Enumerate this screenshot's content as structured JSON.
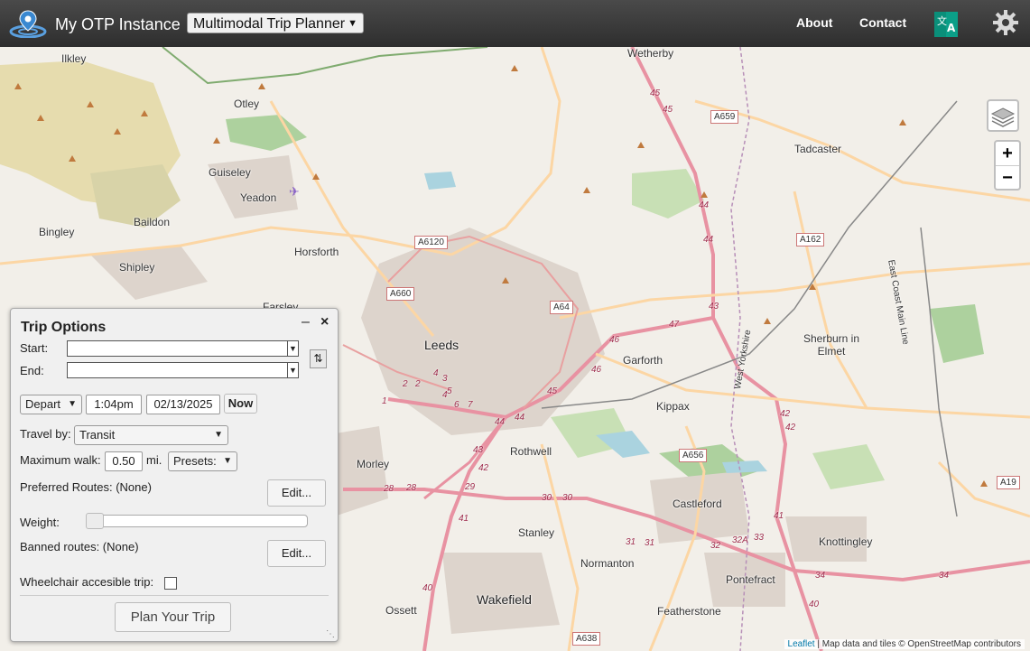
{
  "app": {
    "title": "My OTP Instance",
    "mode_selected": "Multimodal Trip Planner"
  },
  "nav": {
    "about": "About",
    "contact": "Contact"
  },
  "map": {
    "places": [
      "Wetherby",
      "Ilkley",
      "Otley",
      "Tadcaster",
      "Guiseley",
      "Yeadon",
      "Baildon",
      "Bingley",
      "Horsforth",
      "Shipley",
      "Farsley",
      "Leeds",
      "Garforth",
      "Sherburn in Elmet",
      "Kippax",
      "Rothwell",
      "Morley",
      "Castleford",
      "Stanley",
      "Knottingley",
      "Normanton",
      "Pontefract",
      "Wakefield",
      "Ossett",
      "Featherstone",
      "East Coast Main Line",
      "West Yorkshire"
    ],
    "roads": [
      "A659",
      "A6120",
      "A162",
      "A660",
      "A64",
      "A656",
      "A19",
      "A638"
    ],
    "junctions": [
      "45",
      "45",
      "44",
      "44",
      "43",
      "47",
      "46",
      "46",
      "45",
      "44",
      "44",
      "43",
      "42",
      "42",
      "42",
      "41",
      "41",
      "29",
      "30",
      "30",
      "31",
      "31",
      "32",
      "32A",
      "33",
      "34",
      "34",
      "40",
      "40",
      "28",
      "28",
      "1",
      "2",
      "2",
      "3",
      "4",
      "5",
      "6",
      "7",
      "4"
    ],
    "zoom_in": "+",
    "zoom_out": "−",
    "attribution_link": "Leaflet",
    "attribution_text": " | Map data and tiles © OpenStreetMap contributors"
  },
  "trip_options": {
    "title": "Trip Options",
    "start_label": "Start:",
    "start_value": "",
    "end_label": "End:",
    "end_value": "",
    "depart_option": "Depart",
    "time": "1:04pm",
    "date": "02/13/2025",
    "now_button": "Now",
    "travel_by_label": "Travel by:",
    "travel_by_value": "Transit",
    "max_walk_label": "Maximum walk:",
    "max_walk_value": "0.50",
    "max_walk_unit": "mi.",
    "presets": "Presets:",
    "preferred_routes": "Preferred Routes: (None)",
    "edit_preferred": "Edit...",
    "weight_label": "Weight:",
    "weight_value": 0,
    "banned_routes": "Banned routes: (None)",
    "edit_banned": "Edit...",
    "wheelchair_label": "Wheelchair accesible trip:",
    "plan_button": "Plan Your Trip"
  },
  "colors": {
    "topbar": "#3b3b3b",
    "motorway": "#e892a2",
    "primary": "#fcd6a4",
    "urban": "#d9d0c9",
    "forest": "#add19e",
    "water": "#aad3df"
  }
}
